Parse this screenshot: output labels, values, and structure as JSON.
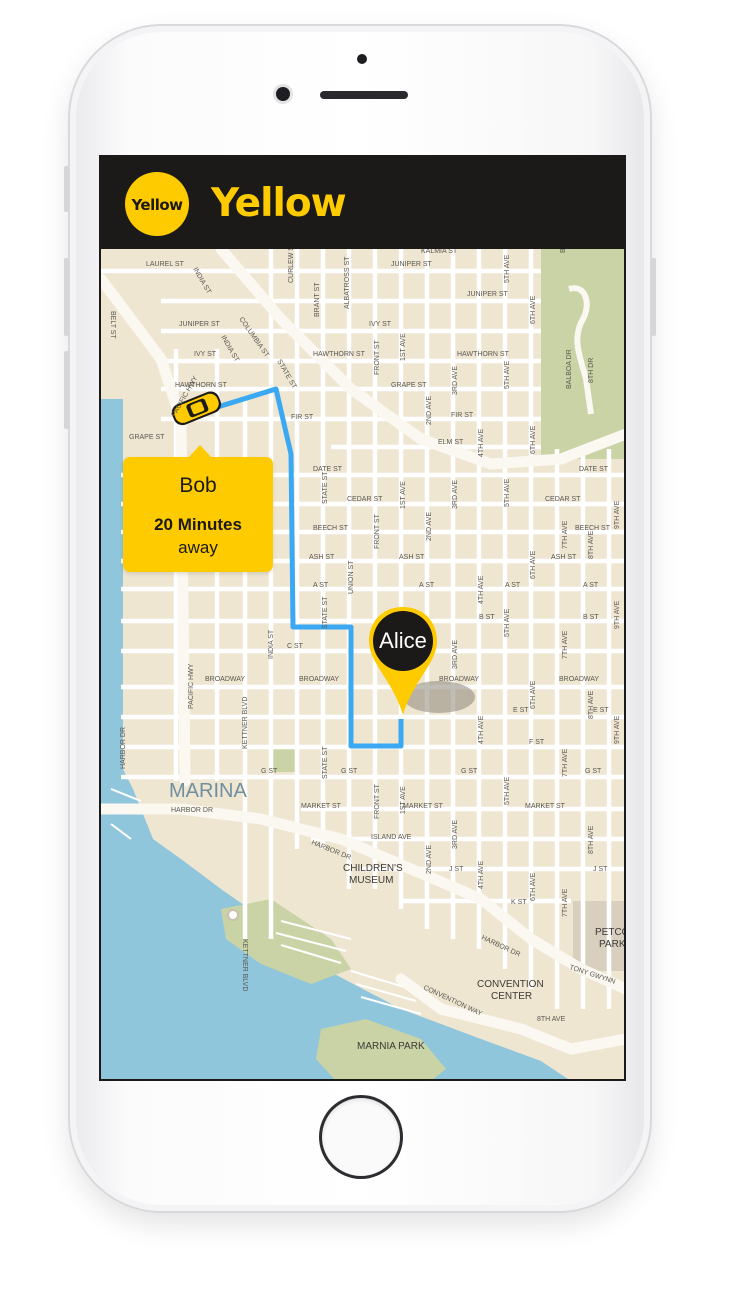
{
  "app": {
    "name": "Yellow",
    "logo_text": "Yellow"
  },
  "driver": {
    "name": "Bob",
    "eta": "20 Minutes",
    "eta_suffix": "away"
  },
  "rider": {
    "name": "Alice"
  },
  "map": {
    "area_label": "MARINA",
    "street_labels": [
      "LAUREL ST",
      "JUNIPER ST",
      "IVY ST",
      "HAWTHORN ST",
      "GRAPE ST",
      "FIR ST",
      "ELM ST",
      "DATE ST",
      "CEDAR ST",
      "BEECH ST",
      "ASH ST",
      "A ST",
      "B ST",
      "C ST",
      "BROADWAY",
      "E ST",
      "F ST",
      "G ST",
      "MARKET ST",
      "ISLAND AVE",
      "J ST",
      "K ST",
      "KALMIA ST",
      "HARBOR DR",
      "PACIFIC HWY",
      "KETTNER BLVD",
      "INDIA ST",
      "STATE ST",
      "UNION ST",
      "FRONT ST",
      "1ST AVE",
      "2ND AVE",
      "3RD AVE",
      "4TH AVE",
      "5TH AVE",
      "6TH AVE",
      "7TH AVE",
      "8TH AVE",
      "9TH AVE",
      "BALBOA DR",
      "CONVENTION WAY",
      "TONY GWYNN",
      "BRANT ST",
      "ALBATROSS ST",
      "CURLEW ST",
      "COLUMBIA ST",
      "BELT ST",
      "FRONT ST"
    ],
    "pois": [
      "CHILDREN'S MUSEUM",
      "CONVENTION CENTER",
      "MARNIA PARK",
      "PETCO PARK"
    ]
  },
  "colors": {
    "brand": "#fecb00",
    "dark": "#1c1a19",
    "route": "#3aa8f2",
    "land": "#efe6d2",
    "water": "#8fc6dc",
    "park": "#c9d3a5"
  }
}
